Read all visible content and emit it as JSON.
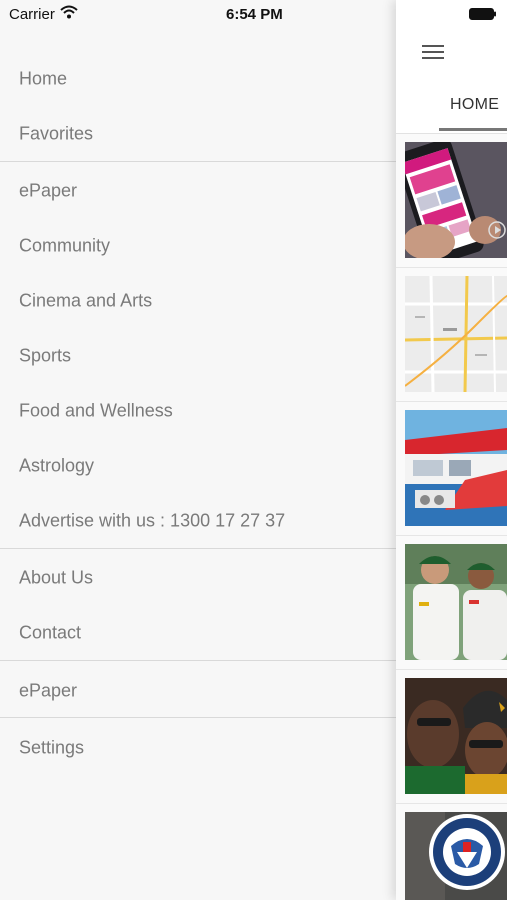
{
  "status_bar": {
    "carrier": "Carrier",
    "time": "6:54 PM"
  },
  "menu": {
    "groups": [
      [
        {
          "label": "Home"
        },
        {
          "label": "Favorites"
        }
      ],
      [
        {
          "label": "ePaper"
        },
        {
          "label": "Community"
        },
        {
          "label": "Cinema and Arts"
        },
        {
          "label": "Sports"
        },
        {
          "label": "Food and Wellness"
        },
        {
          "label": "Astrology"
        },
        {
          "label": "Advertise with us : 1300 17 27 37"
        }
      ],
      [
        {
          "label": "About Us"
        },
        {
          "label": "Contact"
        }
      ],
      [
        {
          "label": "ePaper"
        }
      ],
      [
        {
          "label": "Settings"
        }
      ]
    ]
  },
  "content": {
    "tabs": [
      {
        "label": "HOME",
        "selected": true
      }
    ],
    "articles": [
      {
        "thumbnail": "phone-app-image"
      },
      {
        "thumbnail": "map-image"
      },
      {
        "thumbnail": "boat-image"
      },
      {
        "thumbnail": "cricket-players-image"
      },
      {
        "thumbnail": "people-portrait-image"
      },
      {
        "thumbnail": "homeland-security-seal-image"
      }
    ]
  },
  "colors": {
    "drawer_background": "#f7f7f7",
    "menu_text": "#7a7a7a",
    "divider": "#d9d9d9",
    "tab_indicator": "#777777"
  }
}
